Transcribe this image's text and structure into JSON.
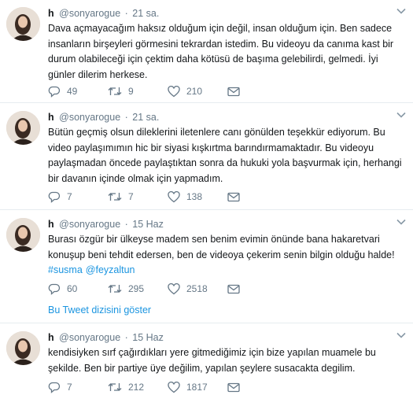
{
  "tweets": [
    {
      "name": "h",
      "handle": "@sonyarogue",
      "time": "21 sa.",
      "lines": [
        "Dava açmayacağım haksız olduğum için değil, insan olduğum için. Ben sadece",
        "insanların birşeyleri görmesini tekrardan istedim. Bu videoyu da canıma kast bir",
        "durum olabileceği için çektim daha kötüsü de başıma gelebilirdi, gelmedi. İyi",
        "günler dilerim herkese."
      ],
      "hashtags": [],
      "replies": "49",
      "retweets": "9",
      "likes": "210"
    },
    {
      "name": "h",
      "handle": "@sonyarogue",
      "time": "21 sa.",
      "lines": [
        "Bütün geçmiş olsun dileklerini iletenlere canı gönülden teşekkür ediyorum. Bu",
        "video paylaşımımın hic bir siyasi kışkırtma barındırmamaktadır. Bu videoyu",
        "paylaşmadan öncede paylaştıktan sonra da hukuki yola başvurmak için, herhangi",
        "bir davanın içinde olmak için yapmadım."
      ],
      "hashtags": [],
      "replies": "7",
      "retweets": "7",
      "likes": "138"
    },
    {
      "name": "h",
      "handle": "@sonyarogue",
      "time": "15 Haz",
      "lines": [
        "Burası özgür bir ülkeyse madem sen benim evimin önünde bana hakaretvari",
        "konuşup beni tehdit edersen, ben de videoya çekerim senin bilgin olduğu halde!"
      ],
      "hashtags": [
        "#susma",
        "@feyzaltun"
      ],
      "replies": "60",
      "retweets": "295",
      "likes": "2518",
      "thread_link": "Bu Tweet dizisini göster"
    },
    {
      "name": "h",
      "handle": "@sonyarogue",
      "time": "15 Haz",
      "lines": [
        "kendisiyken sırf çağırdıkları yere gitmediğimiz için bize yapılan  muamele bu",
        "şekilde. Ben bir partiye üye değilim, yapılan şeylere susacakta degilim."
      ],
      "hashtags": [],
      "replies": "7",
      "retweets": "212",
      "likes": "1817"
    }
  ],
  "icons": {
    "reply": "reply-icon",
    "retweet": "retweet-icon",
    "like": "heart-icon",
    "message": "envelope-icon",
    "more": "chevron-down-icon"
  },
  "colors": {
    "text": "#14171a",
    "secondary": "#657786",
    "link": "#1b95e0",
    "separator": "#e6ecf0"
  }
}
